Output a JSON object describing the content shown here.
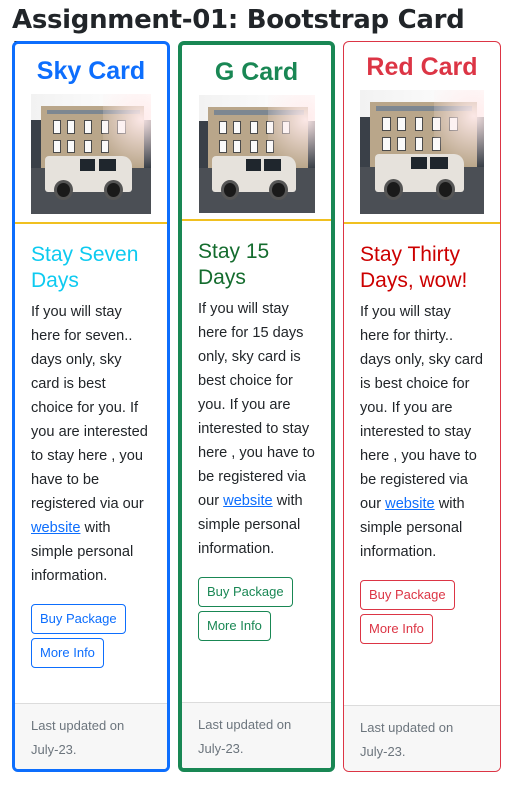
{
  "page_title": "Assignment-01: Bootstrap Card Layout",
  "colors": {
    "blue": "#0d6efd",
    "green": "#198754",
    "red": "#dc3545",
    "cyan": "#0dcaf0",
    "divider_yellow": "#f0c020"
  },
  "cards": [
    {
      "title": "Sky Card",
      "heading": "Stay Seven Days",
      "text_before_link": "If you will stay here for seven.. days only, sky card is best choice for you. If you are interested to stay here , you have to be registered via our",
      "link_text": "website",
      "text_after_link": "with simple personal information.",
      "buy_label": "Buy Package",
      "more_label": "More Info",
      "footer": "Last updated on July-23.",
      "image_icon": "house-and-car-photo"
    },
    {
      "title": "G Card",
      "heading": "Stay 15 Days",
      "text_before_link": "If you will stay here for 15 days only, sky card is best choice for you. If you are interested to stay here , you have to be registered via our",
      "link_text": "website",
      "text_after_link": "with simple personal information.",
      "buy_label": "Buy Package",
      "more_label": "More Info",
      "footer": "Last updated on July-23.",
      "image_icon": "house-and-car-photo"
    },
    {
      "title": "Red Card",
      "heading": "Stay Thirty Days, wow!",
      "text_before_link": "If you will stay here for thirty.. days only, sky card is best choice for you. If you are interested to stay here , you have to be registered via our",
      "link_text": "website",
      "text_after_link": "with simple personal information.",
      "buy_label": "Buy Package",
      "more_label": "More Info",
      "footer": "Last updated on July-23.",
      "image_icon": "house-and-car-photo"
    }
  ]
}
